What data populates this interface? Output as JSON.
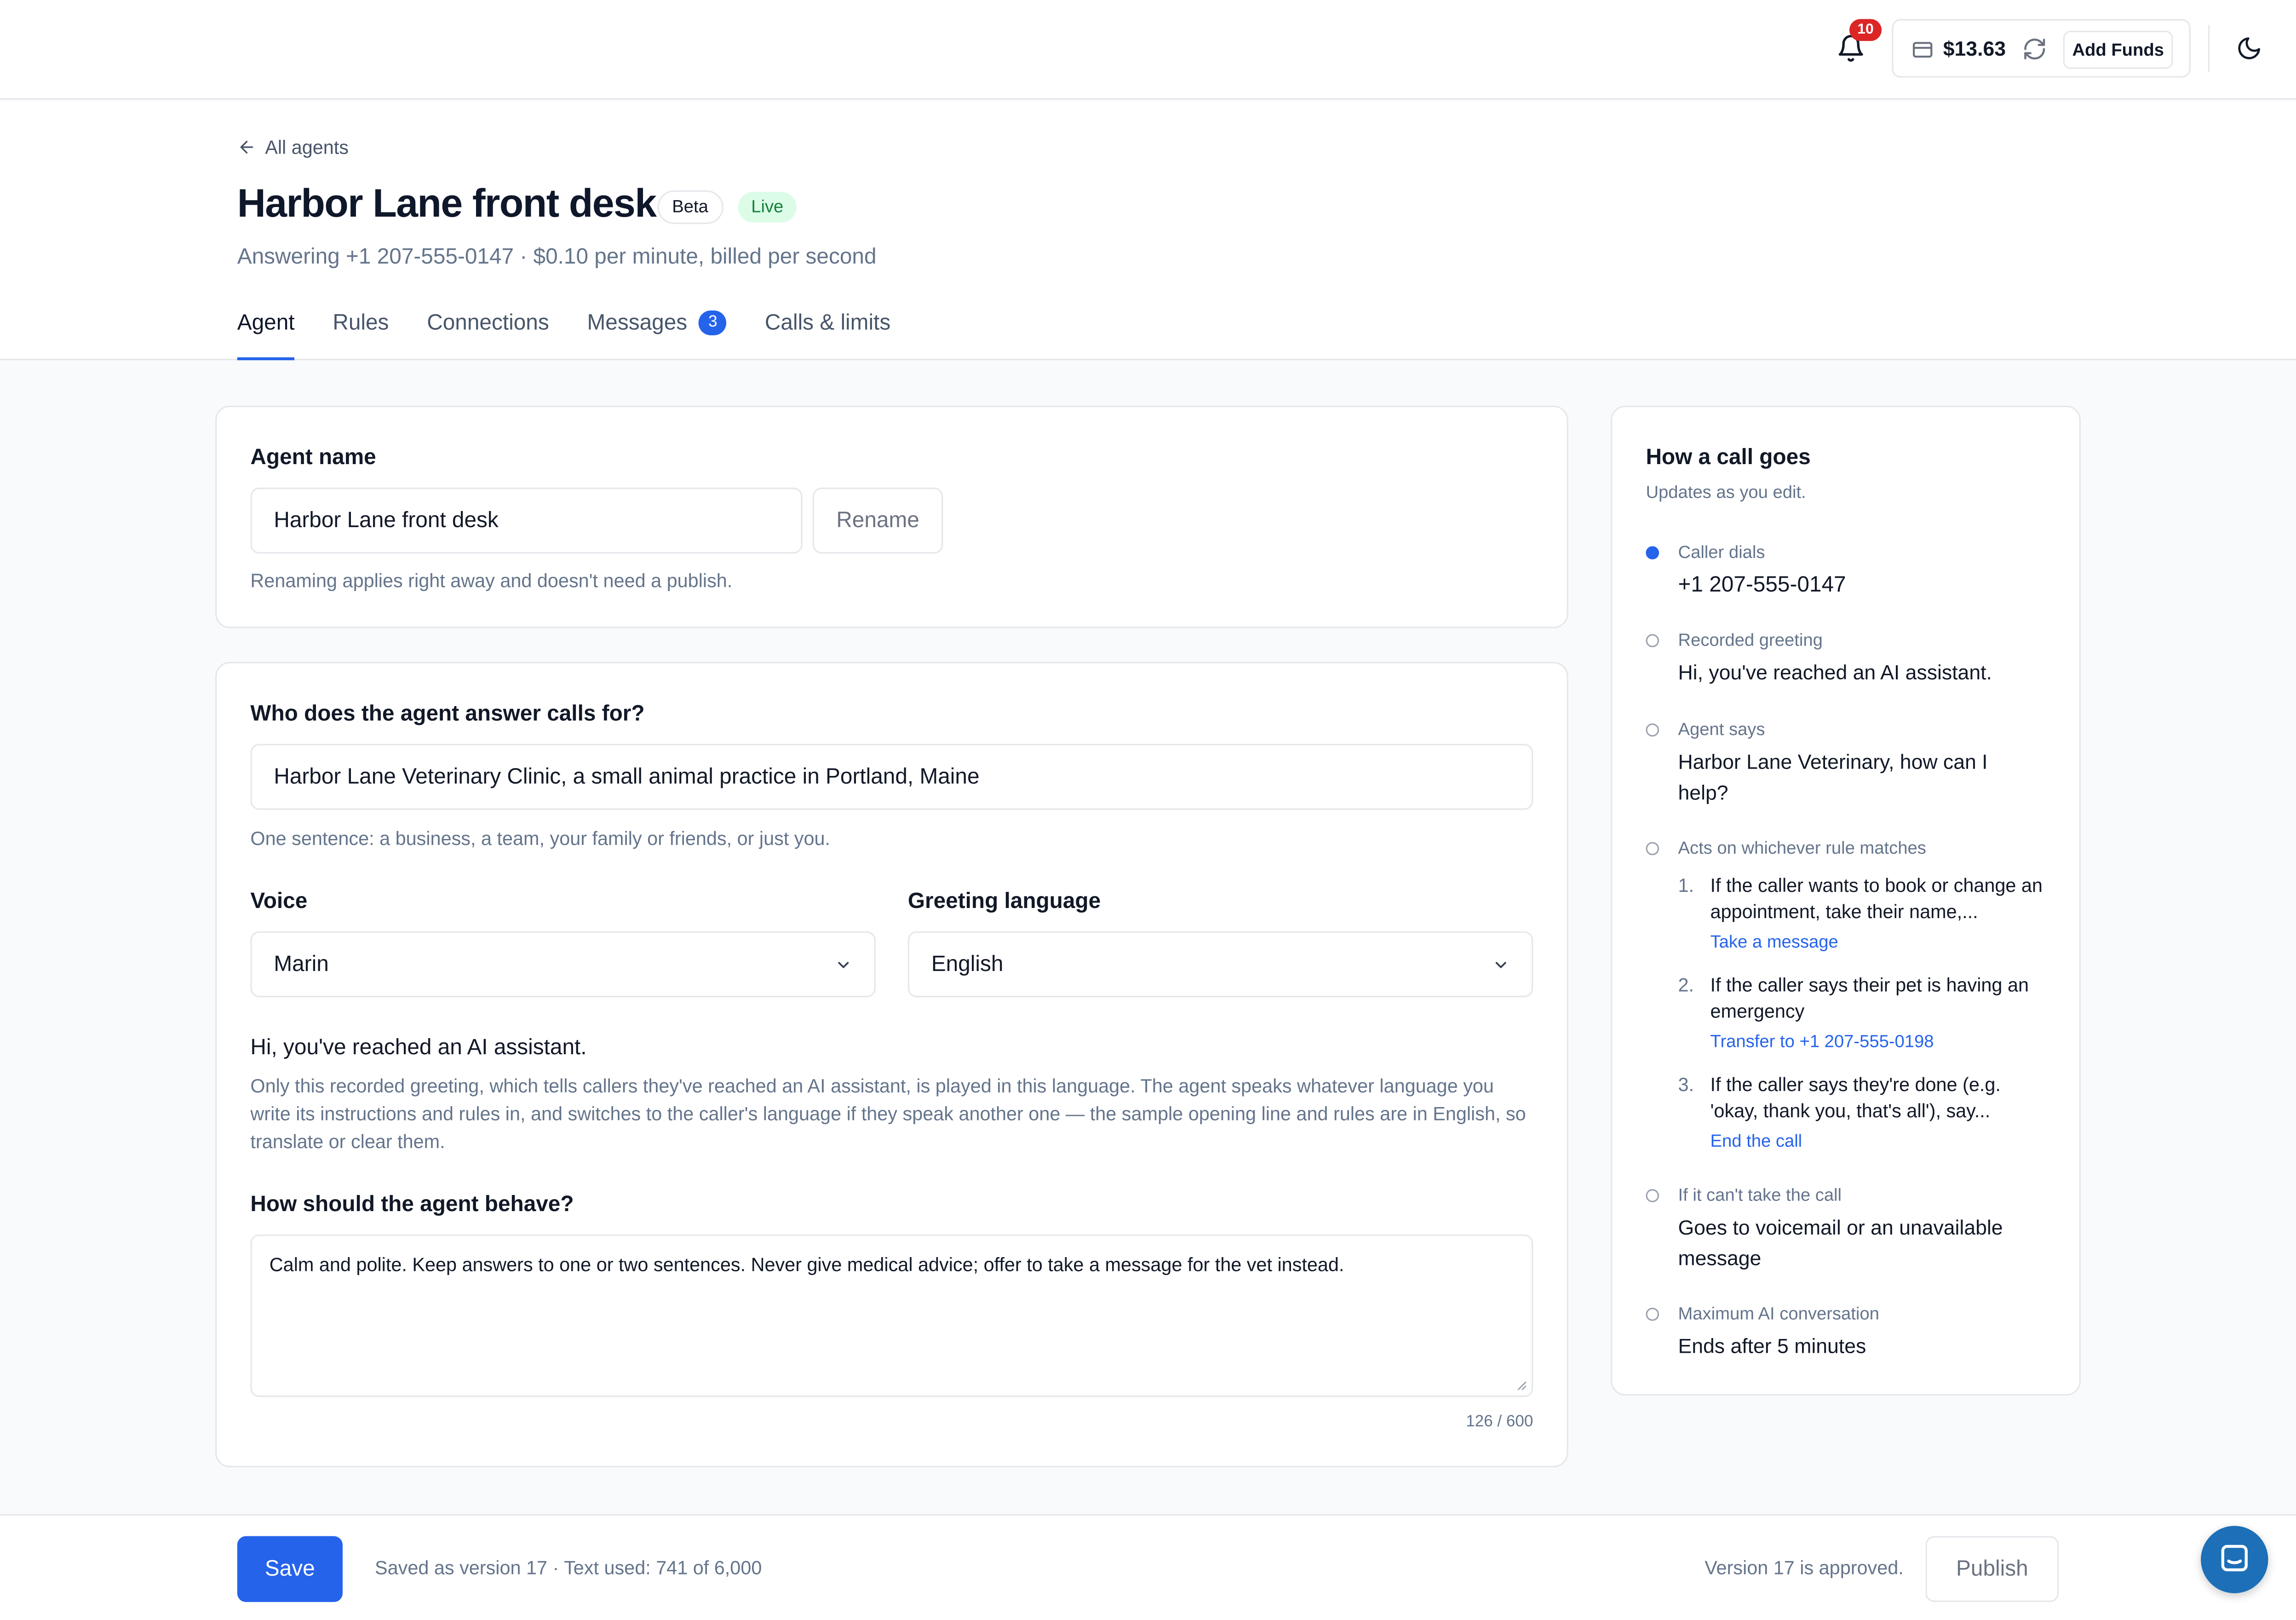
{
  "topbar": {
    "notification_count": "10",
    "balance": "$13.63",
    "add_funds_label": "Add Funds"
  },
  "header": {
    "back_label": "All agents",
    "title": "Harbor Lane front desk",
    "badge_beta": "Beta",
    "badge_live": "Live",
    "subtitle": "Answering +1 207-555-0147 · $0.10 per minute, billed per second",
    "tabs": [
      {
        "label": "Agent",
        "active": true
      },
      {
        "label": "Rules"
      },
      {
        "label": "Connections"
      },
      {
        "label": "Messages",
        "count": "3"
      },
      {
        "label": "Calls & limits"
      }
    ]
  },
  "agent_name_card": {
    "label": "Agent name",
    "value": "Harbor Lane front desk",
    "rename_label": "Rename",
    "hint": "Renaming applies right away and doesn't need a publish."
  },
  "config_card": {
    "who_label": "Who does the agent answer calls for?",
    "who_value": "Harbor Lane Veterinary Clinic, a small animal practice in Portland, Maine",
    "who_hint": "One sentence: a business, a team, your family or friends, or just you.",
    "voice_label": "Voice",
    "voice_value": "Marin",
    "language_label": "Greeting language",
    "language_value": "English",
    "greeting_text": "Hi, you've reached an AI assistant.",
    "greeting_hint": "Only this recorded greeting, which tells callers they've reached an AI assistant, is played in this language. The agent speaks whatever language you write its instructions and rules in, and switches to the caller's language if they speak another one — the sample opening line and rules are in English, so translate or clear them.",
    "behave_label": "How should the agent behave?",
    "behave_value": "Calm and polite. Keep answers to one or two sentences. Never give medical advice; offer to take a message for the vet instead.",
    "char_count": "126 / 600"
  },
  "call_flow": {
    "title": "How a call goes",
    "subtitle": "Updates as you edit.",
    "steps": [
      {
        "label": "Caller dials",
        "value": "+1 207-555-0147"
      },
      {
        "label": "Recorded greeting",
        "value": "Hi, you've reached an AI assistant."
      },
      {
        "label": "Agent says",
        "value": "Harbor Lane Veterinary, how can I help?"
      },
      {
        "label": "Acts on whichever rule matches"
      },
      {
        "label": "If it can't take the call",
        "value": "Goes to voicemail or an unavailable message"
      },
      {
        "label": "Maximum AI conversation",
        "value": "Ends after 5 minutes"
      }
    ],
    "rules": [
      {
        "num": "1.",
        "text": "If the caller wants to book or change an appointment, take their name,...",
        "action": "Take a message"
      },
      {
        "num": "2.",
        "text": "If the caller says their pet is having an emergency",
        "action": "Transfer to +1 207-555-0198"
      },
      {
        "num": "3.",
        "text": "If the caller says they're done (e.g. 'okay, thank you, that's all'), say...",
        "action": "End the call"
      }
    ]
  },
  "bottombar": {
    "save_label": "Save",
    "save_status": "Saved as version 17 · Text used: 741 of 6,000",
    "approved_text": "Version 17 is approved.",
    "publish_label": "Publish"
  },
  "colors": {
    "accent": "#2563eb",
    "live_bg": "#dcfce7",
    "live_text": "#15803d",
    "alert": "#dc2626"
  }
}
